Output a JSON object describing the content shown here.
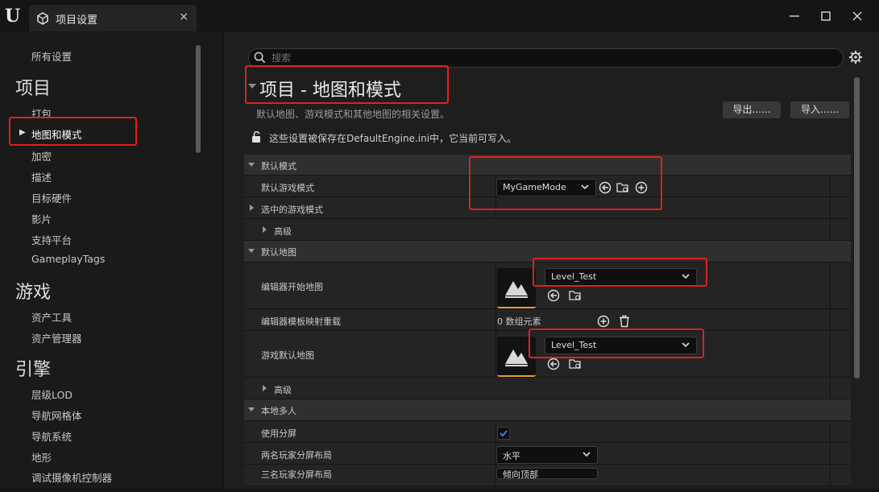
{
  "window": {
    "tab_title": "项目设置",
    "tab_close": "×",
    "icons": {
      "logo": "unreal-logo-icon",
      "tab": "settings-cube-icon",
      "minimize": "minimize-icon",
      "maximize": "maximize-icon",
      "close": "close-icon"
    }
  },
  "sidebar": {
    "all_settings": "所有设置",
    "categories": [
      {
        "label": "项目",
        "items": [
          "打包",
          "地图和模式",
          "加密",
          "描述",
          "目标硬件",
          "影片",
          "支持平台",
          "GameplayTags"
        ]
      },
      {
        "label": "游戏",
        "items": [
          "资产工具",
          "资产管理器"
        ]
      },
      {
        "label": "引擎",
        "items": [
          "层级LOD",
          "导航网格体",
          "导航系统",
          "地形",
          "调试摄像机控制器"
        ]
      }
    ],
    "selected_item": "地图和模式"
  },
  "search": {
    "placeholder": "搜索"
  },
  "header": {
    "title": "项目 - 地图和模式",
    "description": "默认地图、游戏模式和其他地图的相关设置。",
    "export_label": "导出......",
    "import_label": "导入......",
    "lock_notice": "这些设置被保存在DefaultEngine.ini中，它当前可写入。"
  },
  "details": {
    "cat_default_modes": "默认模式",
    "default_game_mode_label": "默认游戏模式",
    "default_game_mode_value": "MyGameMode",
    "selected_game_mode_label": "选中的游戏模式",
    "advanced_label": "高级",
    "cat_default_maps": "默认地图",
    "editor_startup_map_label": "编辑器开始地图",
    "editor_startup_map_value": "Level_Test",
    "editor_template_override_label": "编辑器模板映射重载",
    "editor_template_override_value": "0 数组元素",
    "game_default_map_label": "游戏默认地图",
    "game_default_map_value": "Level_Test",
    "advanced2_label": "高级",
    "cat_local_multiplayer": "本地多人",
    "use_splitscreen_label": "使用分屏",
    "use_splitscreen_checked": true,
    "two_player_layout_label": "两名玩家分屏布局",
    "two_player_layout_value": "水平",
    "three_player_layout_label": "三名玩家分屏布局",
    "three_player_layout_value": "倾向顶部"
  },
  "colors": {
    "accent_orange": "#e8a020",
    "checkbox_blue": "#2f7fd8",
    "highlight_red": "#e02020"
  }
}
